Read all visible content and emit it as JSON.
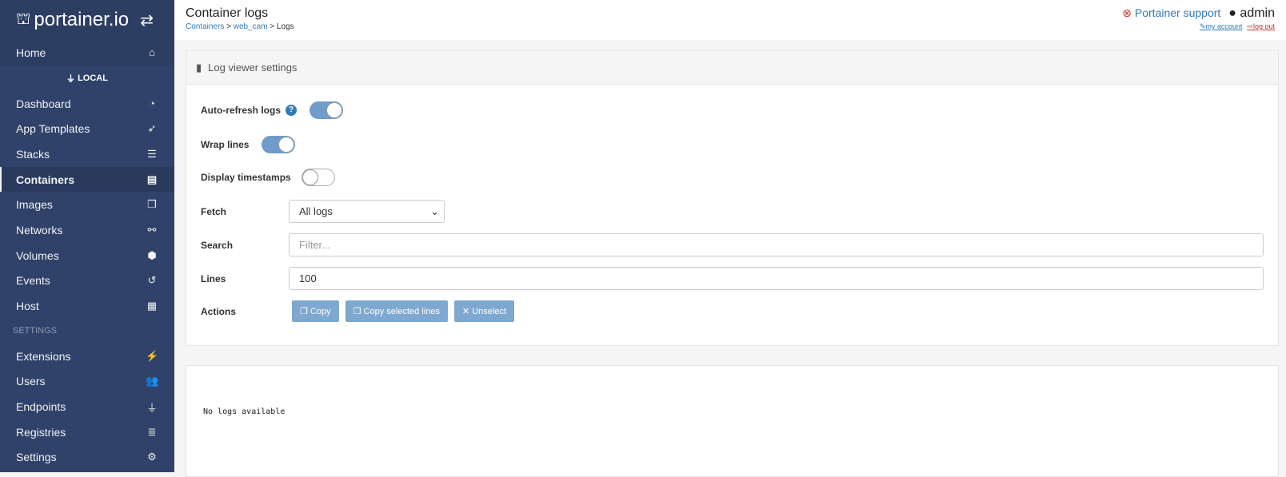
{
  "app": {
    "logo_text": "portainer.io"
  },
  "sidebar": {
    "home": "Home",
    "endpoint": "LOCAL",
    "items": [
      {
        "label": "Dashboard",
        "icon": "tachometer-icon",
        "glyph": "◔"
      },
      {
        "label": "App Templates",
        "icon": "rocket-icon",
        "glyph": "➶"
      },
      {
        "label": "Stacks",
        "icon": "th-list-icon",
        "glyph": "☰"
      },
      {
        "label": "Containers",
        "icon": "server-icon",
        "glyph": "▤",
        "active": true
      },
      {
        "label": "Images",
        "icon": "clone-icon",
        "glyph": "❐"
      },
      {
        "label": "Networks",
        "icon": "sitemap-icon",
        "glyph": "⚯"
      },
      {
        "label": "Volumes",
        "icon": "cubes-icon",
        "glyph": "⬢"
      },
      {
        "label": "Events",
        "icon": "history-icon",
        "glyph": "↺"
      },
      {
        "label": "Host",
        "icon": "th-icon",
        "glyph": "▦"
      }
    ],
    "settings_title": "SETTINGS",
    "settings_items": [
      {
        "label": "Extensions",
        "icon": "bolt-icon",
        "glyph": "⚡"
      },
      {
        "label": "Users",
        "icon": "users-icon",
        "glyph": "👥"
      },
      {
        "label": "Endpoints",
        "icon": "plug-icon",
        "glyph": "⏚"
      },
      {
        "label": "Registries",
        "icon": "database-icon",
        "glyph": "≣"
      },
      {
        "label": "Settings",
        "icon": "cogs-icon",
        "glyph": "⚙"
      }
    ]
  },
  "header": {
    "title": "Container logs",
    "breadcrumb": [
      "Containers",
      "web_cam",
      "Logs"
    ],
    "support": "Portainer support",
    "user": "admin",
    "my_account": "my account",
    "log_out": "log out"
  },
  "settings": {
    "title": "Log viewer settings",
    "auto_refresh": {
      "label": "Auto-refresh logs",
      "on": true
    },
    "wrap": {
      "label": "Wrap lines",
      "on": true
    },
    "timestamps": {
      "label": "Display timestamps",
      "on": false
    },
    "fetch": {
      "label": "Fetch",
      "value": "All logs"
    },
    "search": {
      "label": "Search",
      "placeholder": "Filter..."
    },
    "lines": {
      "label": "Lines",
      "value": "100"
    },
    "actions": {
      "label": "Actions",
      "copy": "Copy",
      "copy_selected": "Copy selected lines",
      "unselect": "Unselect"
    }
  },
  "logs": {
    "message": "No logs available"
  }
}
